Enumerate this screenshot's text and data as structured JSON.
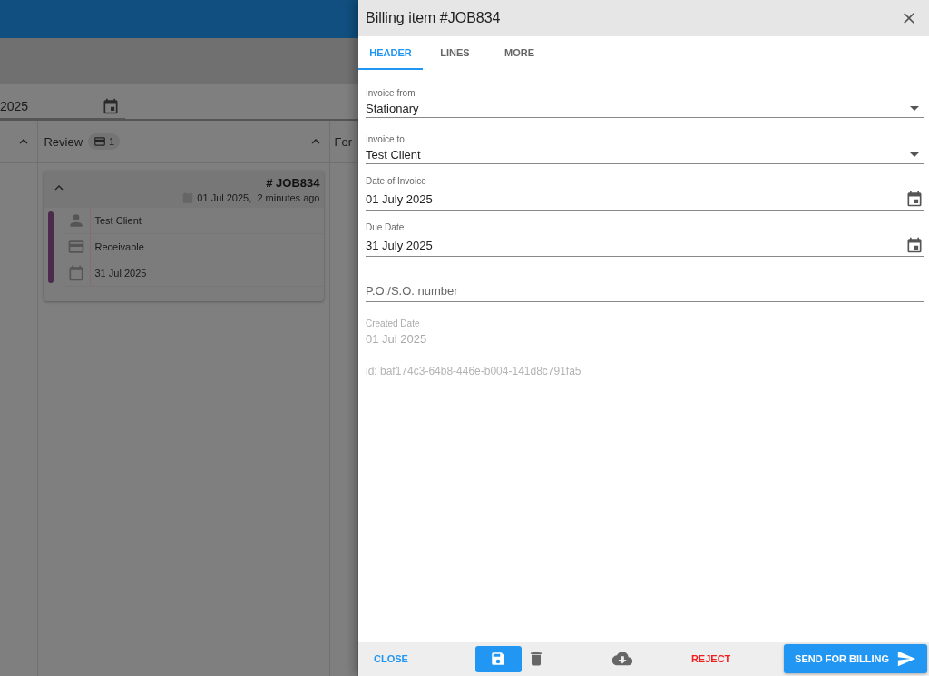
{
  "board": {
    "date_value": "2025",
    "columns": [
      {
        "title": "Review",
        "count": "1",
        "cards": [
          {
            "number": "# JOB834",
            "date": "01 Jul 2025,  2 minutes ago",
            "color": "#4b2a4b",
            "rows": [
              {
                "kind": "client",
                "text": "Test Client"
              },
              {
                "kind": "type",
                "text": "Receivable"
              },
              {
                "kind": "due",
                "text": "31 Jul 2025"
              }
            ]
          }
        ]
      },
      {
        "title": "For"
      }
    ]
  },
  "panel": {
    "title": "Billing item #JOB834",
    "tabs": [
      {
        "label": "HEADER",
        "selected": true
      },
      {
        "label": "LINES",
        "selected": false
      },
      {
        "label": "MORE",
        "selected": false
      }
    ],
    "fields": [
      {
        "kind": "select",
        "label": "Invoice from",
        "value": "Stationary"
      },
      {
        "kind": "select",
        "label": "Invoice to",
        "value": "Test Client"
      },
      {
        "kind": "date",
        "label": "Date of Invoice",
        "value": "01 July 2025"
      },
      {
        "kind": "date",
        "label": "Due Date",
        "value": "31 July 2025"
      },
      {
        "kind": "text",
        "placeholder": "P.O./S.O. number"
      },
      {
        "kind": "readonly",
        "label": "Created Date",
        "value": "01 Jul 2025"
      }
    ],
    "id_text": "id: baf174c3-64b8-446e-b004-141d8c791fa5",
    "footer": [
      {
        "kind": "close",
        "label": "CLOSE"
      },
      {
        "kind": "save"
      },
      {
        "kind": "delete"
      },
      {
        "kind": "download"
      },
      {
        "kind": "reject",
        "label": "REJECT"
      },
      {
        "kind": "send",
        "label": "SEND FOR BILLING"
      }
    ]
  }
}
